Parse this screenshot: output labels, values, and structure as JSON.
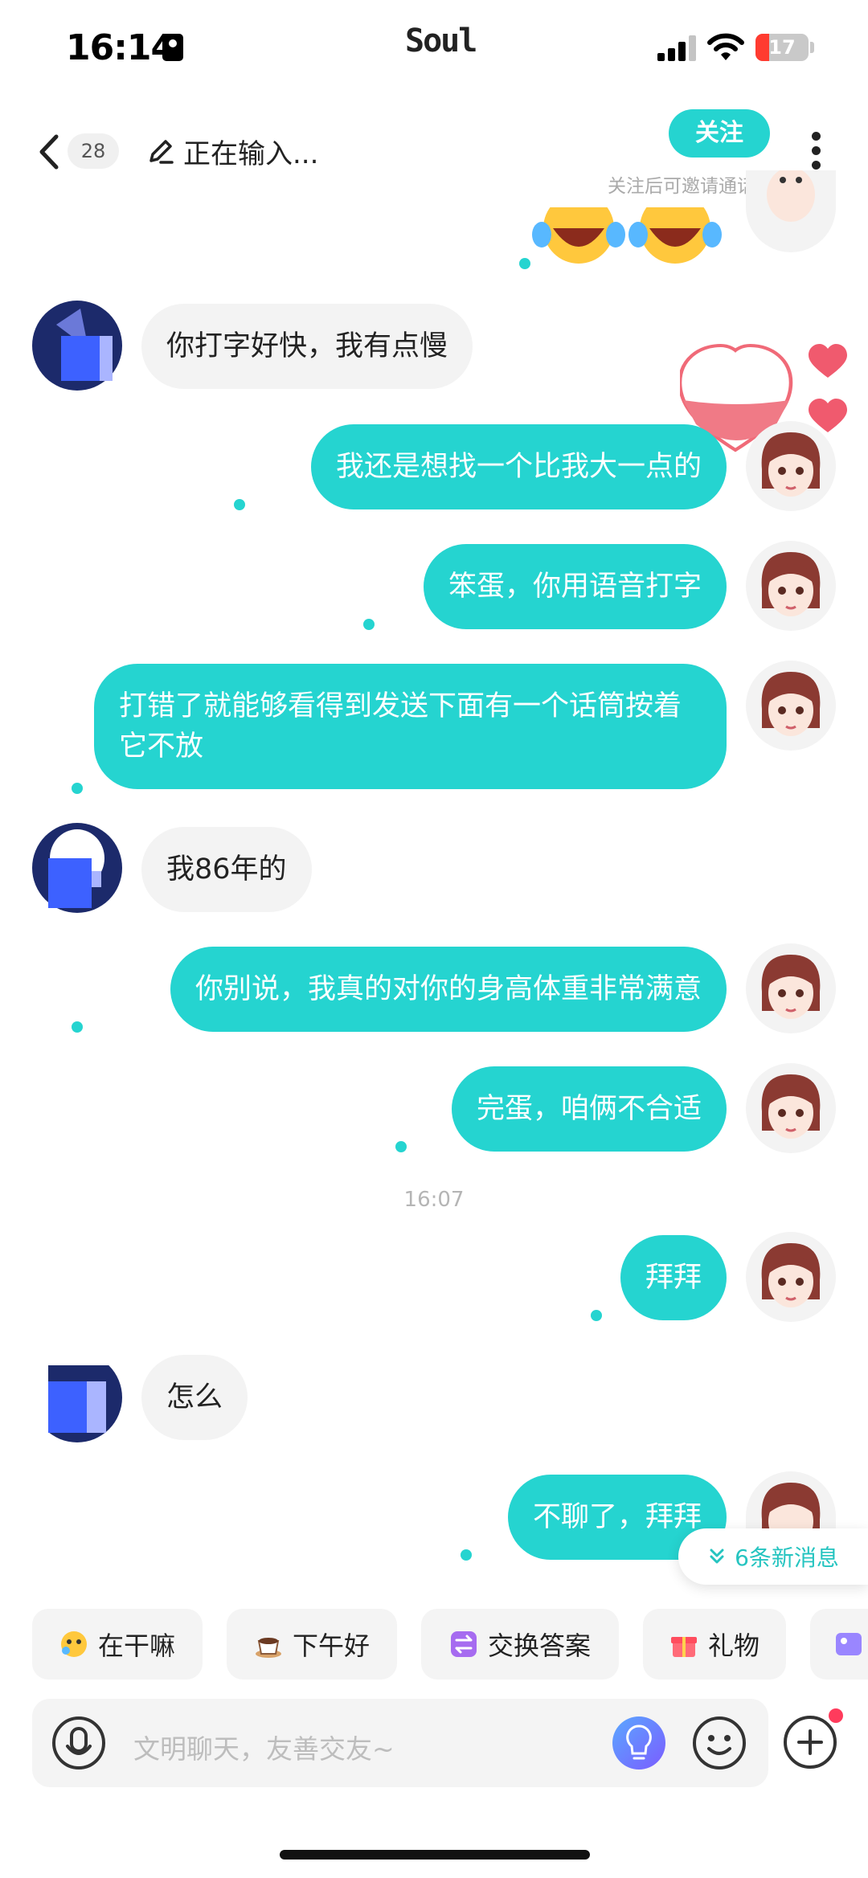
{
  "status_bar": {
    "time": "16:14",
    "app_name": "Soul",
    "battery": "17"
  },
  "header": {
    "unread_count": "28",
    "status_text": "正在输入...",
    "follow_label": "关注",
    "follow_hint": "关注后可邀请通话"
  },
  "messages": [
    {
      "side": "left",
      "text": "你打字好快，我有点慢"
    },
    {
      "side": "right",
      "text": "我还是想找一个比我大一点的"
    },
    {
      "side": "right",
      "text": "笨蛋，你用语音打字"
    },
    {
      "side": "right",
      "text": "打错了就能够看得到发送下面有一个话筒按着它不放"
    },
    {
      "side": "left",
      "text": "我86年的"
    },
    {
      "side": "right",
      "text": "你别说，我真的对你的身高体重非常满意"
    },
    {
      "side": "right",
      "text": "完蛋，咱俩不合适"
    },
    {
      "side": "right",
      "text": "拜拜"
    },
    {
      "side": "left",
      "text": "怎么"
    },
    {
      "side": "right",
      "text": "不聊了，拜拜"
    }
  ],
  "timestamp": "16:07",
  "new_messages": "6条新消息",
  "quick_replies": [
    {
      "label": "在干嘛",
      "icon": "thinking-face-icon"
    },
    {
      "label": "下午好",
      "icon": "coffee-cup-icon"
    },
    {
      "label": "交换答案",
      "icon": "swap-icon"
    },
    {
      "label": "礼物",
      "icon": "gift-icon"
    }
  ],
  "input": {
    "placeholder": "文明聊天，友善交友~"
  },
  "colors": {
    "accent": "#25d4d0",
    "bubble_other": "#f3f3f3",
    "badge_red": "#ff3b5c"
  }
}
